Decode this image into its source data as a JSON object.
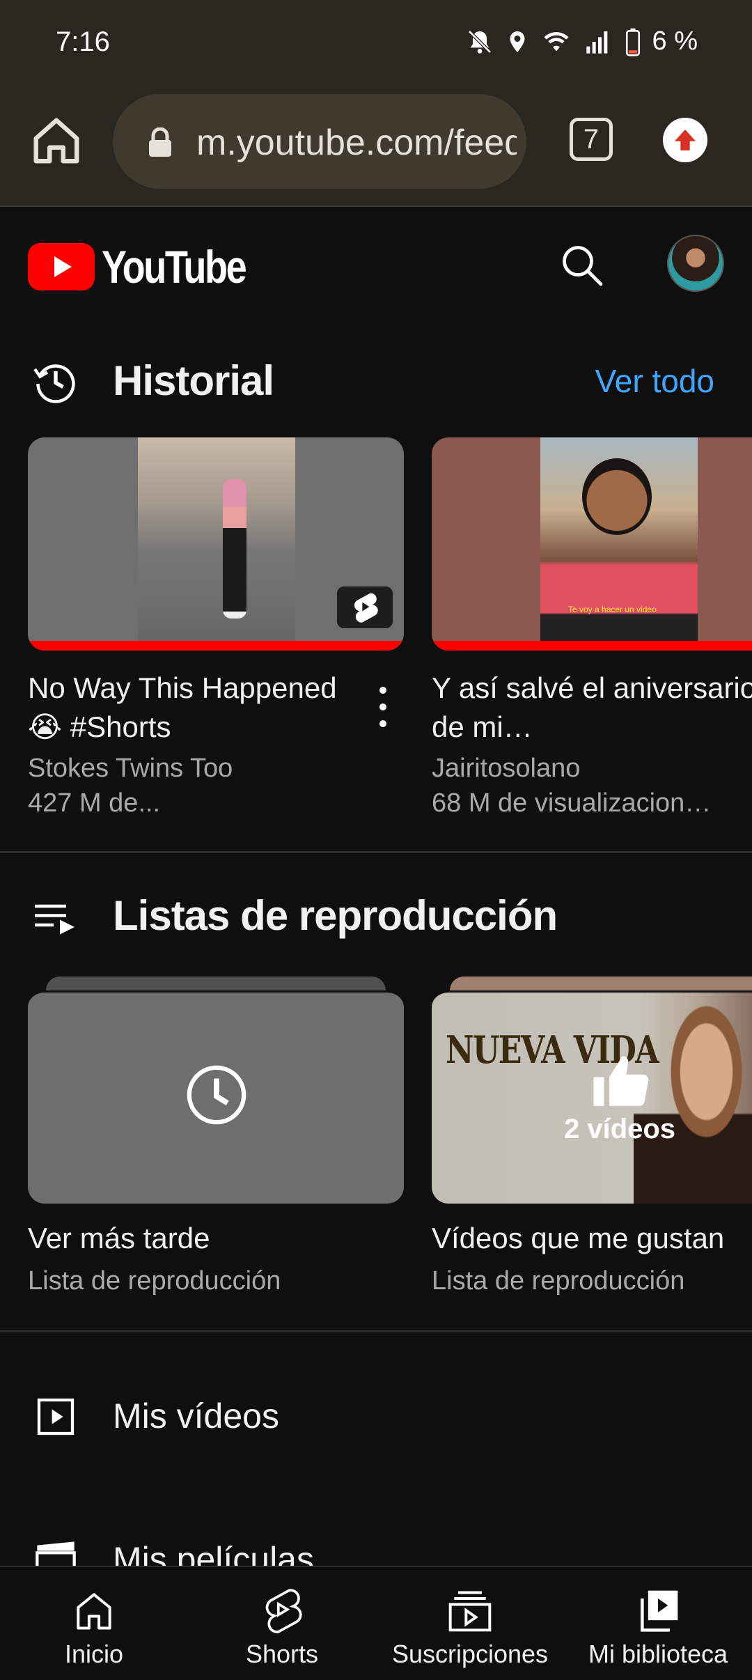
{
  "status_bar": {
    "time": "7:16",
    "battery": "6 %"
  },
  "browser": {
    "url": "m.youtube.com/feed/library",
    "tab_count": "7"
  },
  "header": {
    "logo_text": "YouTube"
  },
  "history": {
    "title": "Historial",
    "see_all": "Ver todo",
    "videos": [
      {
        "title": "No Way This Happened 😭 #Shorts",
        "channel": "Stokes Twins Too",
        "views": "427 M de..."
      },
      {
        "title": "Y así salvé el aniversario de mi…",
        "channel": "Jairitosolano",
        "views": "68 M de visualizacion…",
        "caption": "Te voy a hacer un video"
      }
    ]
  },
  "playlists": {
    "title": "Listas de reproducción",
    "items": [
      {
        "title": "Ver más tarde",
        "subtitle": "Lista de reproducción"
      },
      {
        "title": "Vídeos que me gustan",
        "subtitle": "Lista de reproducción",
        "count": "2 vídeos",
        "thumb_text": "NUEVA VIDA"
      }
    ]
  },
  "library": {
    "items": [
      {
        "label": "Mis vídeos",
        "icon": "play-square-icon"
      },
      {
        "label": "Mis películas",
        "icon": "clapper-icon"
      }
    ]
  },
  "bottom_nav": [
    {
      "label": "Inicio",
      "icon": "home-icon"
    },
    {
      "label": "Shorts",
      "icon": "shorts-icon"
    },
    {
      "label": "Suscripciones",
      "icon": "subscriptions-icon"
    },
    {
      "label": "Mi biblioteca",
      "icon": "library-icon"
    }
  ],
  "colors": {
    "accent": "#3ea6ff",
    "brand": "#ff0000",
    "background": "#0f0f0f",
    "browser_bar": "#2a2620"
  }
}
